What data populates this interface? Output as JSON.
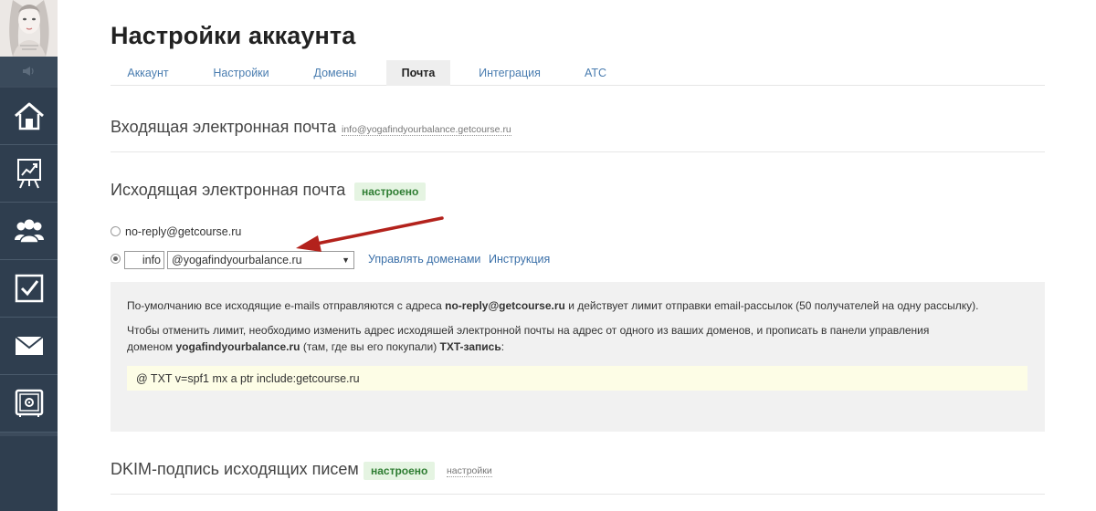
{
  "header": {
    "title": "Настройки аккаунта"
  },
  "tabs": [
    {
      "label": "Аккаунт",
      "active": false
    },
    {
      "label": "Настройки",
      "active": false
    },
    {
      "label": "Домены",
      "active": false
    },
    {
      "label": "Почта",
      "active": true
    },
    {
      "label": "Интеграция",
      "active": false
    },
    {
      "label": "АТС",
      "active": false
    }
  ],
  "incoming": {
    "title": "Входящая электронная почта",
    "address": "info@yogafindyourbalance.getcourse.ru"
  },
  "outgoing": {
    "title": "Исходящая электронная почта",
    "status": "настроено",
    "option_default": "no-reply@getcourse.ru",
    "local_part_value": "info",
    "domain_selected": "@yogafindyourbalance.ru",
    "manage_domains_link": "Управлять доменами",
    "instructions_link": "Инструкция"
  },
  "info": {
    "p1_before": "По-умолчанию все исходящие e-mails отправляются с адреса ",
    "p1_bold": "no-reply@getcourse.ru",
    "p1_after": " и действует лимит отправки email-рассылок (50 получателей на одну рассылку).",
    "p2_line1": "Чтобы отменить лимит, необходимо изменить адрес исходяшей электронной почты на адрес от одного из ваших доменов, и прописать в панели управления",
    "p2_line2_before": "доменом ",
    "p2_domain_bold": "yogafindyourbalance.ru",
    "p2_line2_middle": " (там, где вы его покупали) ",
    "p2_txt_bold": "TXT-запись",
    "p2_line2_after": ":",
    "txt_record": "@ TXT v=spf1 mx a ptr include:getcourse.ru"
  },
  "dkim": {
    "title": "DKIM-подпись исходящих писем",
    "status": "настроено",
    "settings_link": "настройки"
  },
  "colors": {
    "sidebar_bg": "#2f3e4f",
    "link": "#3a6fa8",
    "status_green": "#2e7d32",
    "status_bg": "#e5f4e2",
    "arrow": "#b3221c"
  },
  "sidebar": {
    "icons": [
      "avatar",
      "speaker-icon",
      "home-icon",
      "chart-icon",
      "users-icon",
      "checkbox-icon",
      "mail-icon",
      "safe-icon"
    ]
  }
}
